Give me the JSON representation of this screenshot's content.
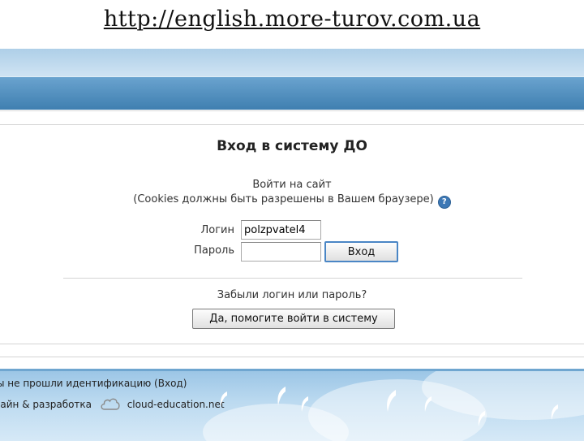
{
  "header": {
    "url_text": "http://english.more-turov.com.ua"
  },
  "login": {
    "title": "Вход в систему ДО",
    "prompt": "Войти на сайт",
    "cookies_note": "(Cookies должны быть разрешены в Вашем браузере)",
    "username_label": "Логин",
    "username_value": "polzpvatel4",
    "password_label": "Пароль",
    "password_value": "",
    "submit_label": "Вход",
    "forgot_prompt": "Забыли логин или пароль?",
    "forgot_button_label": "Да, помогите войти в систему"
  },
  "footer": {
    "auth_status_prefix": "ы не прошли идентификацию (",
    "auth_link": "Вход",
    "auth_status_suffix": ")",
    "credit_prefix": "зайн & разработка",
    "credit_site": "cloud-education.net"
  },
  "icons": {
    "help": "help-icon",
    "cloud": "cloud-icon",
    "bird": "bird-icon"
  },
  "colors": {
    "top_bar": "#3f7fb0",
    "footer_sky": "#9cc6e6",
    "login_button_border": "#4a86c5",
    "help_icon": "#3d78b5"
  }
}
